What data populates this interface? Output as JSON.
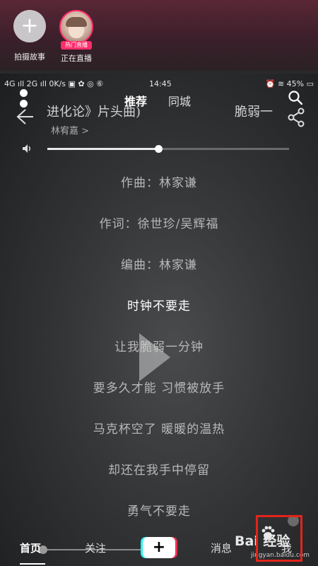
{
  "stories": {
    "add_label": "拍摄故事",
    "live_label": "正在直播",
    "live_badge": "热门直播"
  },
  "status_bar": {
    "left": "4G ıll 2G ıll 0K/s ▣ ✿ ◎ ⑥",
    "time": "14:45",
    "right": "⏰ ≋ 45% ▭"
  },
  "tabs": {
    "recommend": "推荐",
    "city": "同城"
  },
  "song": {
    "title_left": "进化论》片头曲)",
    "title_right": "脆弱一",
    "artist": "林宥嘉 >"
  },
  "volume": {
    "level": 0.46
  },
  "lyrics": [
    "作曲：林家谦",
    "作词：徐世珍/吴辉福",
    "编曲：林家谦",
    "时钟不要走",
    "让我脆弱一分钟",
    "要多久才能 习惯被放手",
    "马克杯空了 暖暖的温热",
    "却还在我手中停留",
    "勇气不要走"
  ],
  "active_lyric_index": 3,
  "bottom_nav": {
    "home": "首页",
    "follow": "关注",
    "add": "+",
    "messages": "消息",
    "me": "我"
  },
  "watermark": {
    "brand": "Bai 经验",
    "url": "jingyan.baidu.com"
  },
  "colors": {
    "accent_pink": "#ff2d6a",
    "highlight_red": "#e3241b",
    "tiktok_cyan": "#25f4ee",
    "tiktok_red": "#fe2c55"
  }
}
